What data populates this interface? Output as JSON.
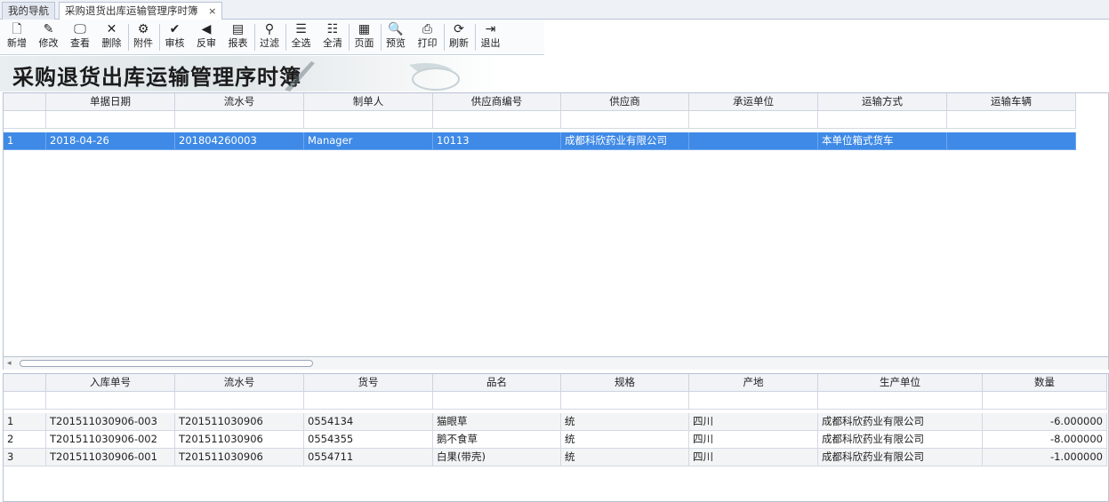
{
  "tabs": [
    {
      "label": "我的导航"
    },
    {
      "label": "采购退货出库运输管理序时簿"
    }
  ],
  "tab_close": "×",
  "toolbar": [
    {
      "label": "新增",
      "icon": "new-document-icon",
      "glyph": "🗋"
    },
    {
      "label": "修改",
      "icon": "edit-icon",
      "glyph": "✎"
    },
    {
      "label": "查看",
      "icon": "view-icon",
      "glyph": "🖵"
    },
    {
      "label": "删除",
      "icon": "delete-icon",
      "glyph": "✕"
    },
    {
      "label": "附件",
      "icon": "attachment-icon",
      "glyph": "⚙"
    },
    {
      "label": "审核",
      "icon": "audit-icon",
      "glyph": "✔"
    },
    {
      "label": "反审",
      "icon": "unaudit-icon",
      "glyph": "◀"
    },
    {
      "label": "报表",
      "icon": "report-icon",
      "glyph": "▤"
    },
    {
      "label": "过滤",
      "icon": "binoculars-icon",
      "glyph": "⚲"
    },
    {
      "label": "全选",
      "icon": "select-all-icon",
      "glyph": "☰"
    },
    {
      "label": "全清",
      "icon": "clear-all-icon",
      "glyph": "☷"
    },
    {
      "label": "页面",
      "icon": "page-icon",
      "glyph": "▦"
    },
    {
      "label": "预览",
      "icon": "preview-icon",
      "glyph": "🔍"
    },
    {
      "label": "打印",
      "icon": "print-icon",
      "glyph": "⎙"
    },
    {
      "label": "刷新",
      "icon": "refresh-icon",
      "glyph": "⟳"
    },
    {
      "label": "退出",
      "icon": "exit-icon",
      "glyph": "⇥"
    }
  ],
  "colors": {
    "selected_row": "#3f8ae6",
    "header_bg": "#f1f3f7"
  },
  "page_title": "采购退货出库运输管理序时簿",
  "master": {
    "columns": [
      "单据日期",
      "流水号",
      "制单人",
      "供应商编号",
      "供应商",
      "承运单位",
      "运输方式",
      "运输车辆"
    ],
    "rows": [
      {
        "n": "1",
        "cells": [
          "2018-04-26",
          "201804260003",
          "Manager",
          "10113",
          "成都科欣药业有限公司",
          "",
          "本单位箱式货车",
          ""
        ]
      }
    ]
  },
  "scroll_arrow": "◂",
  "detail": {
    "columns": [
      "入库单号",
      "流水号",
      "货号",
      "品名",
      "规格",
      "产地",
      "生产单位",
      "数量"
    ],
    "rows": [
      {
        "n": "1",
        "cells": [
          "T201511030906-003",
          "T201511030906",
          "0554134",
          "猫眼草",
          "统",
          "四川",
          "成都科欣药业有限公司",
          "-6.000000"
        ]
      },
      {
        "n": "2",
        "cells": [
          "T201511030906-002",
          "T201511030906",
          "0554355",
          "鹅不食草",
          "统",
          "四川",
          "成都科欣药业有限公司",
          "-8.000000"
        ]
      },
      {
        "n": "3",
        "cells": [
          "T201511030906-001",
          "T201511030906",
          "0554711",
          "白果(带壳)",
          "统",
          "四川",
          "成都科欣药业有限公司",
          "-1.000000"
        ]
      }
    ]
  }
}
